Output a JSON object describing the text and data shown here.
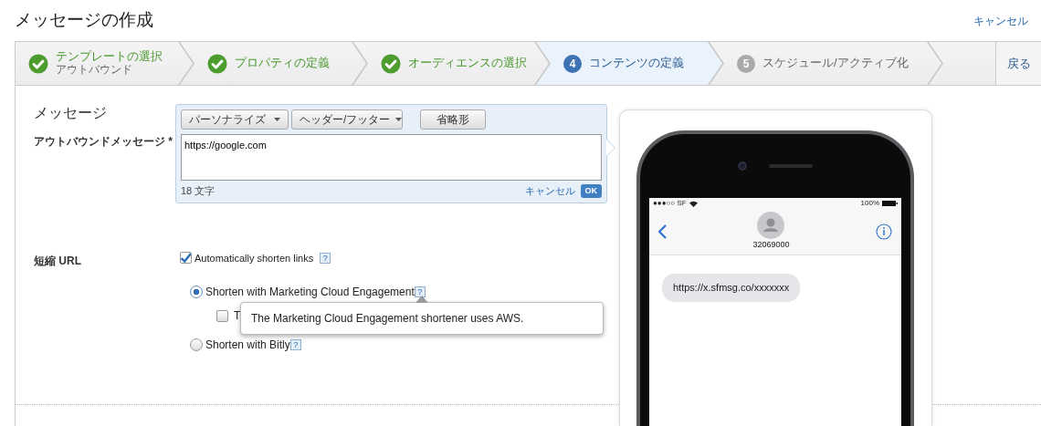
{
  "page": {
    "title": "メッセージの作成",
    "cancel_link": "キャンセル"
  },
  "steps": [
    {
      "label": "テンプレートの選択",
      "sublabel": "アウトバウンド",
      "completed": true,
      "selected": false
    },
    {
      "label": "プロパティの定義",
      "completed": true,
      "selected": false
    },
    {
      "label": "オーディエンスの選択",
      "completed": true,
      "selected": false
    },
    {
      "number": "4",
      "label": "コンテンツの定義",
      "completed": false,
      "selected": true
    },
    {
      "number": "5",
      "label": "スケジュール/アクティブ化",
      "completed": false,
      "selected": false
    }
  ],
  "back_button": "戻る",
  "section_title": "メッセージ",
  "message_field": {
    "label": "アウトバウンドメッセージ",
    "required_mark": "*",
    "toolbar": [
      {
        "label": "パーソナライズ",
        "kind": "dropdown"
      },
      {
        "label": "ヘッダー/フッター",
        "kind": "dropdown"
      },
      {
        "label": "省略形",
        "kind": "button"
      }
    ],
    "value": "https://google.com",
    "char_count": "18 文字",
    "cancel": "キャンセル",
    "ok": "OK"
  },
  "short_url": {
    "label": "短縮 URL",
    "auto_shorten": {
      "label": "Automatically shorten links",
      "checked": true,
      "help": "?"
    },
    "options": [
      {
        "label": "Shorten with Marketing Cloud Engagement",
        "selected": true,
        "help": "?",
        "sub_option": {
          "label": "T",
          "checked": false
        },
        "tooltip": "The Marketing Cloud Engagement shortener uses AWS."
      },
      {
        "label": "Shorten with Bitly",
        "selected": false,
        "help": "?"
      }
    ]
  },
  "preview": {
    "carrier": "●●●○○ SF",
    "battery": "100%",
    "contact": "32069000",
    "bubble": "https://x.sfmsg.co/xxxxxxx"
  }
}
